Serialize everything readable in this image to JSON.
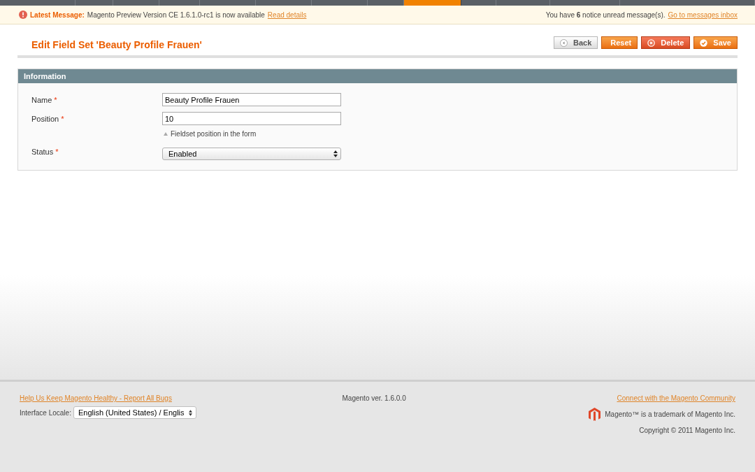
{
  "nav_tabs": [
    {
      "selected": false
    },
    {
      "selected": false
    },
    {
      "selected": false
    },
    {
      "selected": false
    },
    {
      "selected": false
    },
    {
      "selected": false
    },
    {
      "selected": false
    },
    {
      "selected": false
    },
    {
      "selected": true
    },
    {
      "selected": false
    },
    {
      "selected": false
    },
    {
      "selected": false
    },
    {
      "selected": false
    }
  ],
  "message_bar": {
    "label": "Latest Message:",
    "text": "Magento Preview Version CE 1.6.1.0-rc1 is now available",
    "link": "Read details",
    "notice": "You have **6** notice unread message(s).",
    "inbox_link": "Go to messages inbox"
  },
  "page_title": "Edit Field Set 'Beauty Profile Frauen'",
  "buttons": [
    {
      "kind": "back",
      "label": "Back"
    },
    {
      "kind": "reset",
      "label": "Reset"
    },
    {
      "kind": "delete",
      "label": "Delete"
    },
    {
      "kind": "save",
      "label": "Save"
    }
  ],
  "section": {
    "title": "Information",
    "required_marker": "*",
    "fields": [
      {
        "kind": "text",
        "label": "Name",
        "required": true,
        "value": "Beauty Profile Frauen"
      },
      {
        "kind": "text",
        "label": "Position",
        "required": true,
        "value": "10",
        "note": "Fieldset position in the form"
      },
      {
        "kind": "select",
        "label": "Status",
        "required": true,
        "value": "Enabled"
      }
    ]
  },
  "footer": {
    "bug_link": "Help Us Keep Magento Healthy - Report All Bugs",
    "locale_label": "Interface Locale:",
    "locale_value": "English (United States) / Englis",
    "version": "Magento ver. 1.6.0.0",
    "community_link": "Connect with the Magento Community",
    "trademark": "Magento™ is a trademark of Magento Inc.",
    "copyright": "Copyright © 2011 Magento Inc."
  }
}
